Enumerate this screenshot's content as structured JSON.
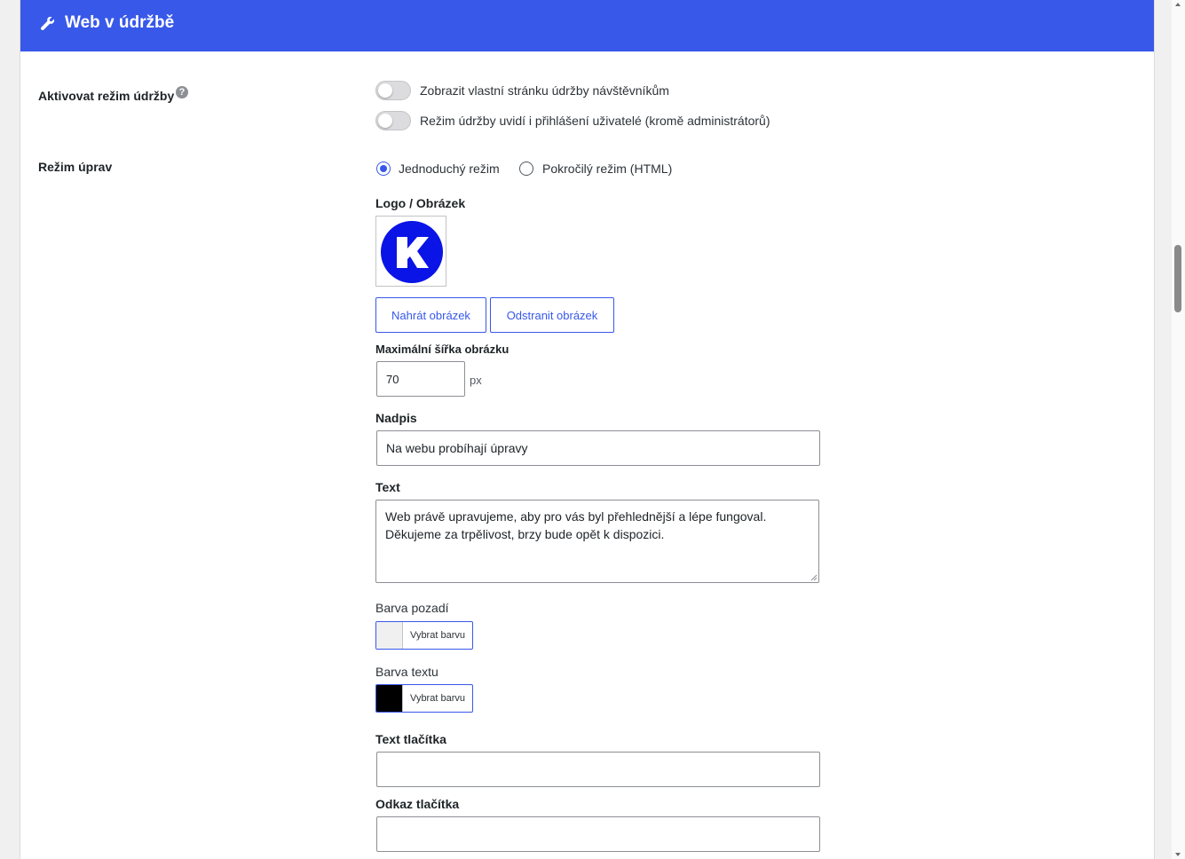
{
  "header": {
    "title": "Web v údržbě",
    "icon": "wrench-icon"
  },
  "maintenance": {
    "label": "Aktivovat režim údržby",
    "help_icon": "?",
    "toggle_visitors": {
      "label": "Zobrazit vlastní stránku údržby návštěvníkům",
      "enabled": false
    },
    "toggle_logged_in": {
      "label": "Režim údržby uvidí i přihlášení uživatelé (kromě administrátorů)",
      "enabled": false
    }
  },
  "edit_mode": {
    "label": "Režim úprav",
    "options": [
      {
        "label": "Jednoduchý režim",
        "checked": true
      },
      {
        "label": "Pokročilý režim (HTML)",
        "checked": false
      }
    ]
  },
  "logo": {
    "label": "Logo / Obrázek",
    "logo_letter": "K",
    "logo_color": "#0a14e6",
    "upload_button": "Nahrát obrázek",
    "remove_button": "Odstranit obrázek"
  },
  "max_width": {
    "label": "Maximální šířka obrázku",
    "value": "70",
    "unit": "px"
  },
  "heading": {
    "label": "Nadpis",
    "value": "Na webu probíhají úpravy"
  },
  "text": {
    "label": "Text",
    "line1": "Web právě upravujeme, aby pro vás byl přehlednější a lépe fungoval.",
    "line2": "Děkujeme za trpělivost, brzy bude opět k dispozici."
  },
  "bg_color": {
    "label": "Barva pozadí",
    "button": "Vybrat barvu",
    "color": "#f0f0f1"
  },
  "text_color": {
    "label": "Barva textu",
    "button": "Vybrat barvu",
    "color": "#000000"
  },
  "button_text": {
    "label": "Text tlačítka",
    "value": ""
  },
  "button_link": {
    "label": "Odkaz tlačítka",
    "value": ""
  },
  "colors": {
    "accent": "#3858e9"
  }
}
